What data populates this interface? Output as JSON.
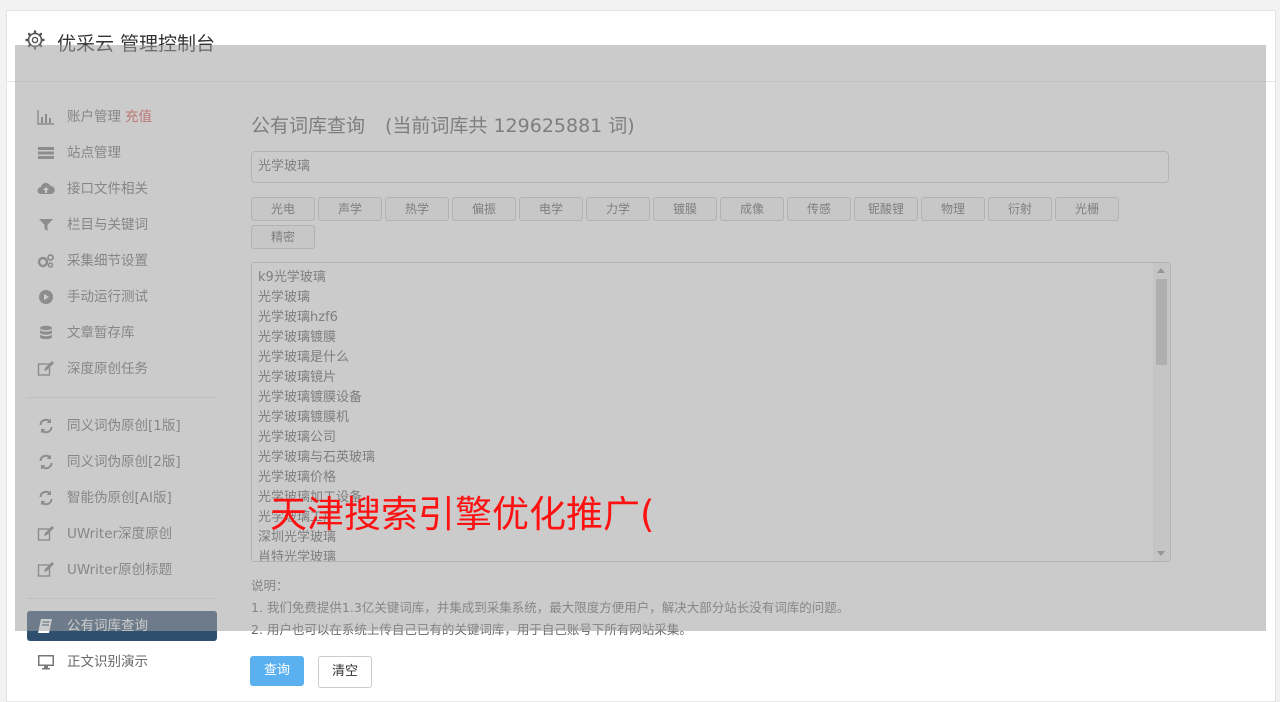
{
  "app": {
    "title": "优采云 管理控制台"
  },
  "sidebar": {
    "group1": [
      {
        "label": "账户管理",
        "accent": "充值",
        "icon": "bar-chart-icon"
      },
      {
        "label": "站点管理",
        "icon": "server-icon"
      },
      {
        "label": "接口文件相关",
        "icon": "cloud-upload-icon"
      },
      {
        "label": "栏目与关键词",
        "icon": "filter-icon"
      },
      {
        "label": "采集细节设置",
        "icon": "gears-icon"
      },
      {
        "label": "手动运行测试",
        "icon": "play-circle-icon"
      },
      {
        "label": "文章暂存库",
        "icon": "database-icon"
      },
      {
        "label": "深度原创任务",
        "icon": "edit-icon"
      }
    ],
    "group2": [
      {
        "label": "同义词伪原创[1版]",
        "icon": "refresh-icon"
      },
      {
        "label": "同义词伪原创[2版]",
        "icon": "refresh-icon"
      },
      {
        "label": "智能伪原创[AI版]",
        "icon": "refresh-icon"
      },
      {
        "label": "UWriter深度原创",
        "icon": "edit-icon"
      },
      {
        "label": "UWriter原创标题",
        "icon": "edit-icon"
      }
    ],
    "group3": [
      {
        "label": "公有词库查询",
        "icon": "book-icon",
        "active": true
      },
      {
        "label": "正文识别演示",
        "icon": "monitor-icon"
      }
    ]
  },
  "main": {
    "title": "公有词库查询",
    "subtitle": "(当前词库共 129625881 词)",
    "search_value": "光学玻璃",
    "tags": [
      "光电",
      "声学",
      "热学",
      "偏振",
      "电学",
      "力学",
      "镀膜",
      "成像",
      "传感",
      "铌酸锂",
      "物理",
      "衍射",
      "光栅",
      "精密"
    ],
    "results": [
      "k9光学玻璃",
      "光学玻璃",
      "光学玻璃hzf6",
      "光学玻璃镀膜",
      "光学玻璃是什么",
      "光学玻璃镜片",
      "光学玻璃镀膜设备",
      "光学玻璃镀膜机",
      "光学玻璃公司",
      "光学玻璃与石英玻璃",
      "光学玻璃价格",
      "光学玻璃加工设备",
      "光学玻璃工厂",
      "深圳光学玻璃",
      "肖特光学玻璃"
    ],
    "notes": {
      "heading": "说明：",
      "line1": "1. 我们免费提供1.3亿关键词库，并集成到采集系统，最大限度方便用户，解决大部分站长没有词库的问题。",
      "line2": "2. 用户也可以在系统上传自己已有的关键词库，用于自己账号下所有网站采集。"
    },
    "buttons": {
      "query": "查询",
      "clear": "清空"
    }
  },
  "watermark": "天津搜索引擎优化推广("
}
